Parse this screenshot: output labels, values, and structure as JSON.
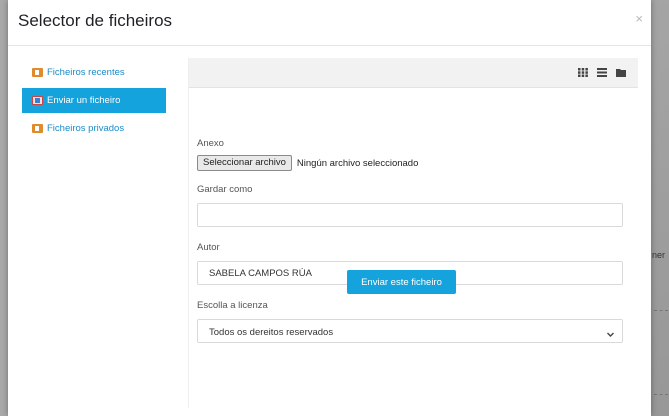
{
  "backdrop": {
    "side_text": "ner"
  },
  "dialog": {
    "title": "Selector de ficheiros",
    "close_glyph": "×"
  },
  "sidebar": {
    "items": [
      {
        "label": "Ficheiros recentes",
        "icon": "recent-files-icon",
        "active": false
      },
      {
        "label": "Enviar un ficheiro",
        "icon": "upload-icon",
        "active": true
      },
      {
        "label": "Ficheiros privados",
        "icon": "private-files-icon",
        "active": false
      }
    ]
  },
  "toolbar": {
    "views": [
      "icons-view-icon",
      "list-view-icon",
      "tree-view-icon"
    ]
  },
  "form": {
    "attachment_label": "Anexo",
    "choose_file_button": "Seleccionar archivo",
    "no_file_text": "Ningún archivo seleccionado",
    "save_as_label": "Gardar como",
    "save_as_value": "",
    "author_label": "Autor",
    "author_value": "SABELA CAMPOS RÚA",
    "license_label": "Escolla a licenza",
    "license_value": "Todos os dereitos reservados",
    "submit_button": "Enviar este ficheiro"
  },
  "colors": {
    "accent": "#14a3dd",
    "link": "#1a8cc9",
    "folder_icon": "#e08b2c"
  }
}
